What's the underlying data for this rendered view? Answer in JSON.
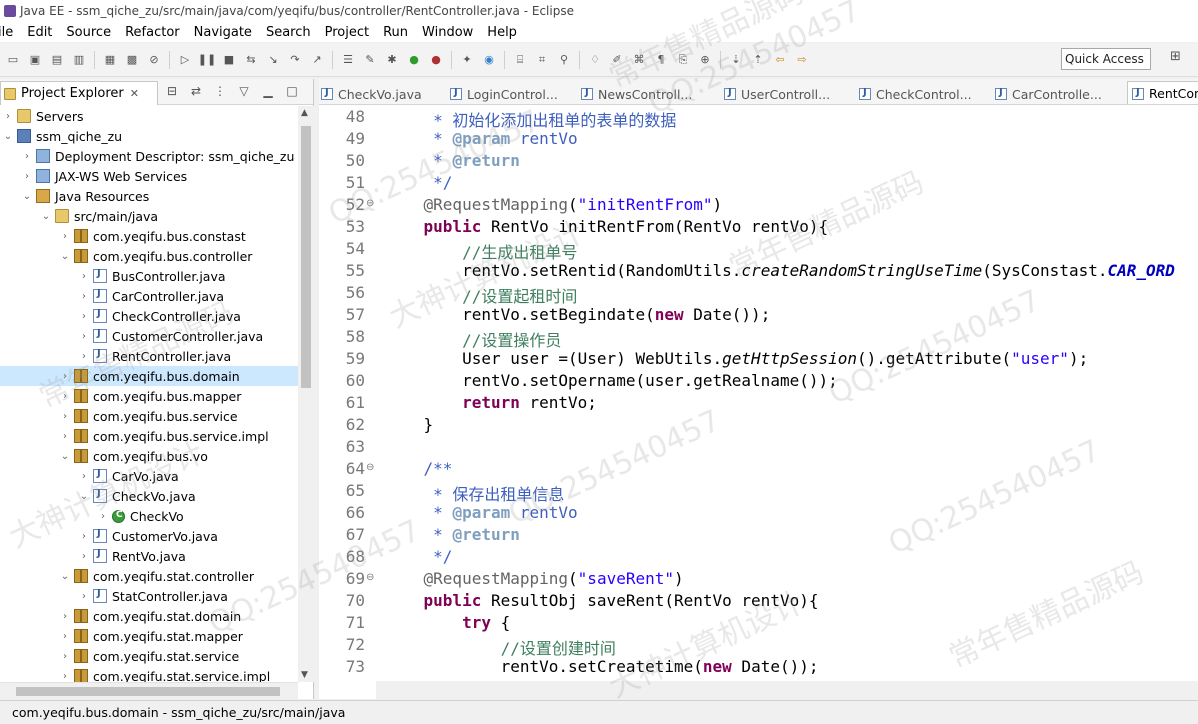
{
  "window": {
    "title": "Java EE - ssm_qiche_zu/src/main/java/com/yeqifu/bus/controller/RentController.java - Eclipse"
  },
  "menu": [
    "ile",
    "Edit",
    "Source",
    "Refactor",
    "Navigate",
    "Search",
    "Project",
    "Run",
    "Window",
    "Help"
  ],
  "toolbar": {
    "quick_access": "Quick Access"
  },
  "explorer": {
    "title": "Project Explorer",
    "close": "✕",
    "tree": [
      {
        "label": "Servers",
        "icon": "folder-icon",
        "twisty": "›",
        "indent": 0
      },
      {
        "label": "ssm_qiche_zu",
        "icon": "project-icon",
        "twisty": "⌄",
        "indent": 0
      },
      {
        "label": "Deployment Descriptor: ssm_qiche_zu",
        "icon": "web-icon",
        "twisty": "›",
        "indent": 1
      },
      {
        "label": "JAX-WS Web Services",
        "icon": "web-icon",
        "twisty": "›",
        "indent": 1
      },
      {
        "label": "Java Resources",
        "icon": "resources-icon",
        "twisty": "⌄",
        "indent": 1
      },
      {
        "label": "src/main/java",
        "icon": "folder-icon",
        "twisty": "⌄",
        "indent": 2
      },
      {
        "label": "com.yeqifu.bus.constast",
        "icon": "package-icon",
        "twisty": "›",
        "indent": 3
      },
      {
        "label": "com.yeqifu.bus.controller",
        "icon": "package-icon",
        "twisty": "⌄",
        "indent": 3
      },
      {
        "label": "BusController.java",
        "icon": "java-icon",
        "twisty": "›",
        "indent": 4
      },
      {
        "label": "CarController.java",
        "icon": "java-icon",
        "twisty": "›",
        "indent": 4
      },
      {
        "label": "CheckController.java",
        "icon": "java-icon",
        "twisty": "›",
        "indent": 4
      },
      {
        "label": "CustomerController.java",
        "icon": "java-icon",
        "twisty": "›",
        "indent": 4
      },
      {
        "label": "RentController.java",
        "icon": "java-icon",
        "twisty": "›",
        "indent": 4
      },
      {
        "label": "com.yeqifu.bus.domain",
        "icon": "package-icon",
        "twisty": "›",
        "indent": 3,
        "selected": true
      },
      {
        "label": "com.yeqifu.bus.mapper",
        "icon": "package-icon",
        "twisty": "›",
        "indent": 3
      },
      {
        "label": "com.yeqifu.bus.service",
        "icon": "package-icon",
        "twisty": "›",
        "indent": 3
      },
      {
        "label": "com.yeqifu.bus.service.impl",
        "icon": "package-icon",
        "twisty": "›",
        "indent": 3
      },
      {
        "label": "com.yeqifu.bus.vo",
        "icon": "package-icon",
        "twisty": "⌄",
        "indent": 3
      },
      {
        "label": "CarVo.java",
        "icon": "java-icon",
        "twisty": "›",
        "indent": 4
      },
      {
        "label": "CheckVo.java",
        "icon": "java-icon",
        "twisty": "⌄",
        "indent": 4
      },
      {
        "label": "CheckVo",
        "icon": "class-icon",
        "twisty": "›",
        "indent": 5
      },
      {
        "label": "CustomerVo.java",
        "icon": "java-icon",
        "twisty": "›",
        "indent": 4
      },
      {
        "label": "RentVo.java",
        "icon": "java-icon",
        "twisty": "›",
        "indent": 4
      },
      {
        "label": "com.yeqifu.stat.controller",
        "icon": "package-icon",
        "twisty": "⌄",
        "indent": 3
      },
      {
        "label": "StatController.java",
        "icon": "java-icon",
        "twisty": "›",
        "indent": 4
      },
      {
        "label": "com.yeqifu.stat.domain",
        "icon": "package-icon",
        "twisty": "›",
        "indent": 3
      },
      {
        "label": "com.yeqifu.stat.mapper",
        "icon": "package-icon",
        "twisty": "›",
        "indent": 3
      },
      {
        "label": "com.yeqifu.stat.service",
        "icon": "package-icon",
        "twisty": "›",
        "indent": 3
      },
      {
        "label": "com.yeqifu.stat.service.impl",
        "icon": "package-icon",
        "twisty": "›",
        "indent": 3
      }
    ]
  },
  "editor": {
    "tabs": [
      {
        "label": "CheckVo.java",
        "active": false
      },
      {
        "label": "LoginControl...",
        "active": false
      },
      {
        "label": "NewsControll...",
        "active": false
      },
      {
        "label": "UserControll...",
        "active": false
      },
      {
        "label": "CheckControl...",
        "active": false
      },
      {
        "label": "CarControlle...",
        "active": false
      },
      {
        "label": "RentCont",
        "active": true
      }
    ],
    "lines": [
      {
        "no": "48",
        "code": "     * 初始化添加出租单的表单的数据",
        "fold": ""
      },
      {
        "no": "49",
        "code": "     * @param rentVo",
        "fold": ""
      },
      {
        "no": "50",
        "code": "     * @return",
        "fold": ""
      },
      {
        "no": "51",
        "code": "     */",
        "fold": ""
      },
      {
        "no": "52",
        "code": "    @RequestMapping(\"initRentFrom\")",
        "fold": "⊖"
      },
      {
        "no": "53",
        "code": "    public RentVo initRentFrom(RentVo rentVo){",
        "fold": ""
      },
      {
        "no": "54",
        "code": "        //生成出租单号",
        "fold": ""
      },
      {
        "no": "55",
        "code": "        rentVo.setRentid(RandomUtils.createRandomStringUseTime(SysConstast.CAR_ORD",
        "fold": ""
      },
      {
        "no": "56",
        "code": "        //设置起租时间",
        "fold": ""
      },
      {
        "no": "57",
        "code": "        rentVo.setBegindate(new Date());",
        "fold": ""
      },
      {
        "no": "58",
        "code": "        //设置操作员",
        "fold": ""
      },
      {
        "no": "59",
        "code": "        User user =(User) WebUtils.getHttpSession().getAttribute(\"user\");",
        "fold": ""
      },
      {
        "no": "60",
        "code": "        rentVo.setOpername(user.getRealname());",
        "fold": ""
      },
      {
        "no": "61",
        "code": "        return rentVo;",
        "fold": ""
      },
      {
        "no": "62",
        "code": "    }",
        "fold": ""
      },
      {
        "no": "63",
        "code": "",
        "fold": ""
      },
      {
        "no": "64",
        "code": "    /**",
        "fold": "⊖"
      },
      {
        "no": "65",
        "code": "     * 保存出租单信息",
        "fold": ""
      },
      {
        "no": "66",
        "code": "     * @param rentVo",
        "fold": ""
      },
      {
        "no": "67",
        "code": "     * @return",
        "fold": ""
      },
      {
        "no": "68",
        "code": "     */",
        "fold": ""
      },
      {
        "no": "69",
        "code": "    @RequestMapping(\"saveRent\")",
        "fold": "⊖"
      },
      {
        "no": "70",
        "code": "    public ResultObj saveRent(RentVo rentVo){",
        "fold": ""
      },
      {
        "no": "71",
        "code": "        try {",
        "fold": ""
      },
      {
        "no": "72",
        "code": "            //设置创建时间",
        "fold": ""
      },
      {
        "no": "73",
        "code": "            rentVo.setCreatetime(new Date());",
        "fold": ""
      }
    ]
  },
  "status": {
    "text": "com.yeqifu.bus.domain - ssm_qiche_zu/src/main/java"
  },
  "watermarks": [
    "QQ:254540457",
    "大神计算机设计",
    "常年售精品源码"
  ],
  "colors": {
    "selection": "#cce8ff",
    "keyword": "#7f0055",
    "string": "#2a00ff",
    "comment": "#3f7f5f"
  }
}
